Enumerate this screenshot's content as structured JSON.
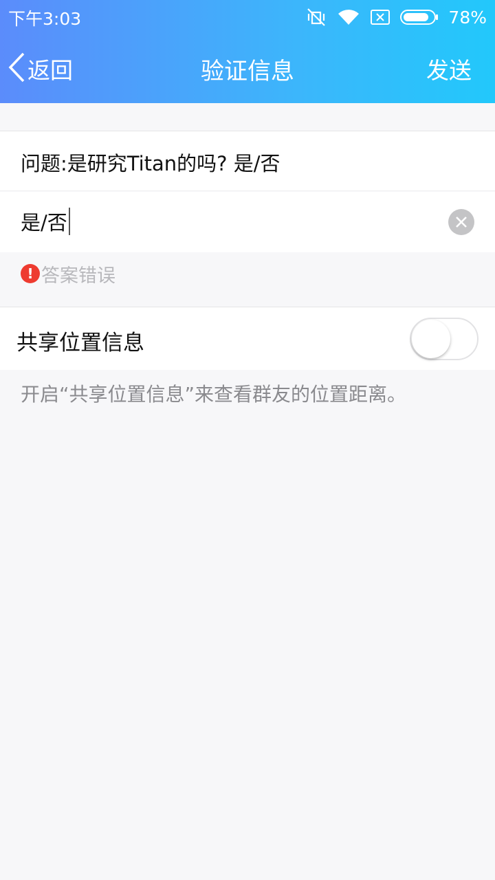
{
  "status_bar": {
    "time": "下午3:03",
    "battery": "78%",
    "icons": [
      "vibrate-off-icon",
      "wifi-icon",
      "sim-error-icon",
      "battery-icon"
    ]
  },
  "nav": {
    "back_label": "返回",
    "title": "验证信息",
    "send_label": "发送"
  },
  "form": {
    "question": "问题:是研究Titan的吗? 是/否",
    "answer_value": "是/否",
    "error_message": "答案错误",
    "error_icon": "!"
  },
  "share_location": {
    "label": "共享位置信息",
    "enabled": false,
    "hint": "开启“共享位置信息”来查看群友的位置距离。"
  },
  "colors": {
    "header_gradient_start": "#5b8cfb",
    "header_gradient_end": "#22c8fb",
    "error": "#ee3b30",
    "background": "#f7f7f9"
  }
}
